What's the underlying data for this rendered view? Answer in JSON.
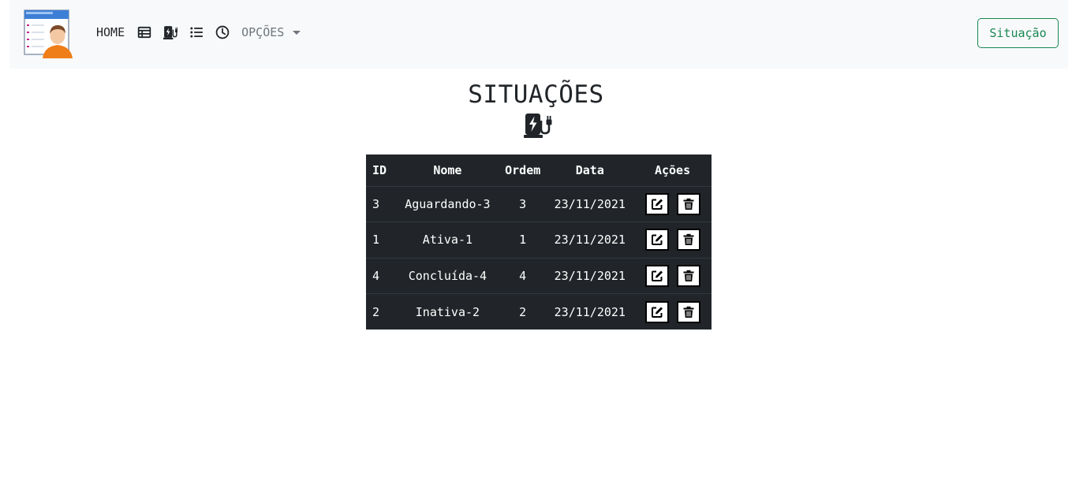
{
  "navbar": {
    "home_label": "HOME",
    "dropdown_label": "OPÇÕES",
    "right_button_label": "Situação",
    "icons": [
      "table-icon",
      "charging-station-icon",
      "list-icon",
      "clock-icon"
    ]
  },
  "page": {
    "title": "SITUAÇÕES",
    "title_icon": "charging-station-icon"
  },
  "table": {
    "headers": [
      "ID",
      "Nome",
      "Ordem",
      "Data",
      "Ações"
    ],
    "rows": [
      {
        "id": "3",
        "nome": "Aguardando-3",
        "ordem": "3",
        "data": "23/11/2021"
      },
      {
        "id": "1",
        "nome": "Ativa-1",
        "ordem": "1",
        "data": "23/11/2021"
      },
      {
        "id": "4",
        "nome": "Concluída-4",
        "ordem": "4",
        "data": "23/11/2021"
      },
      {
        "id": "2",
        "nome": "Inativa-2",
        "ordem": "2",
        "data": "23/11/2021"
      }
    ],
    "row_actions": [
      "edit-icon",
      "trash-icon"
    ]
  },
  "colors": {
    "navbar_bg": "#f8f9fa",
    "table_bg": "#212529",
    "success": "#198754",
    "muted": "#6c757d"
  }
}
